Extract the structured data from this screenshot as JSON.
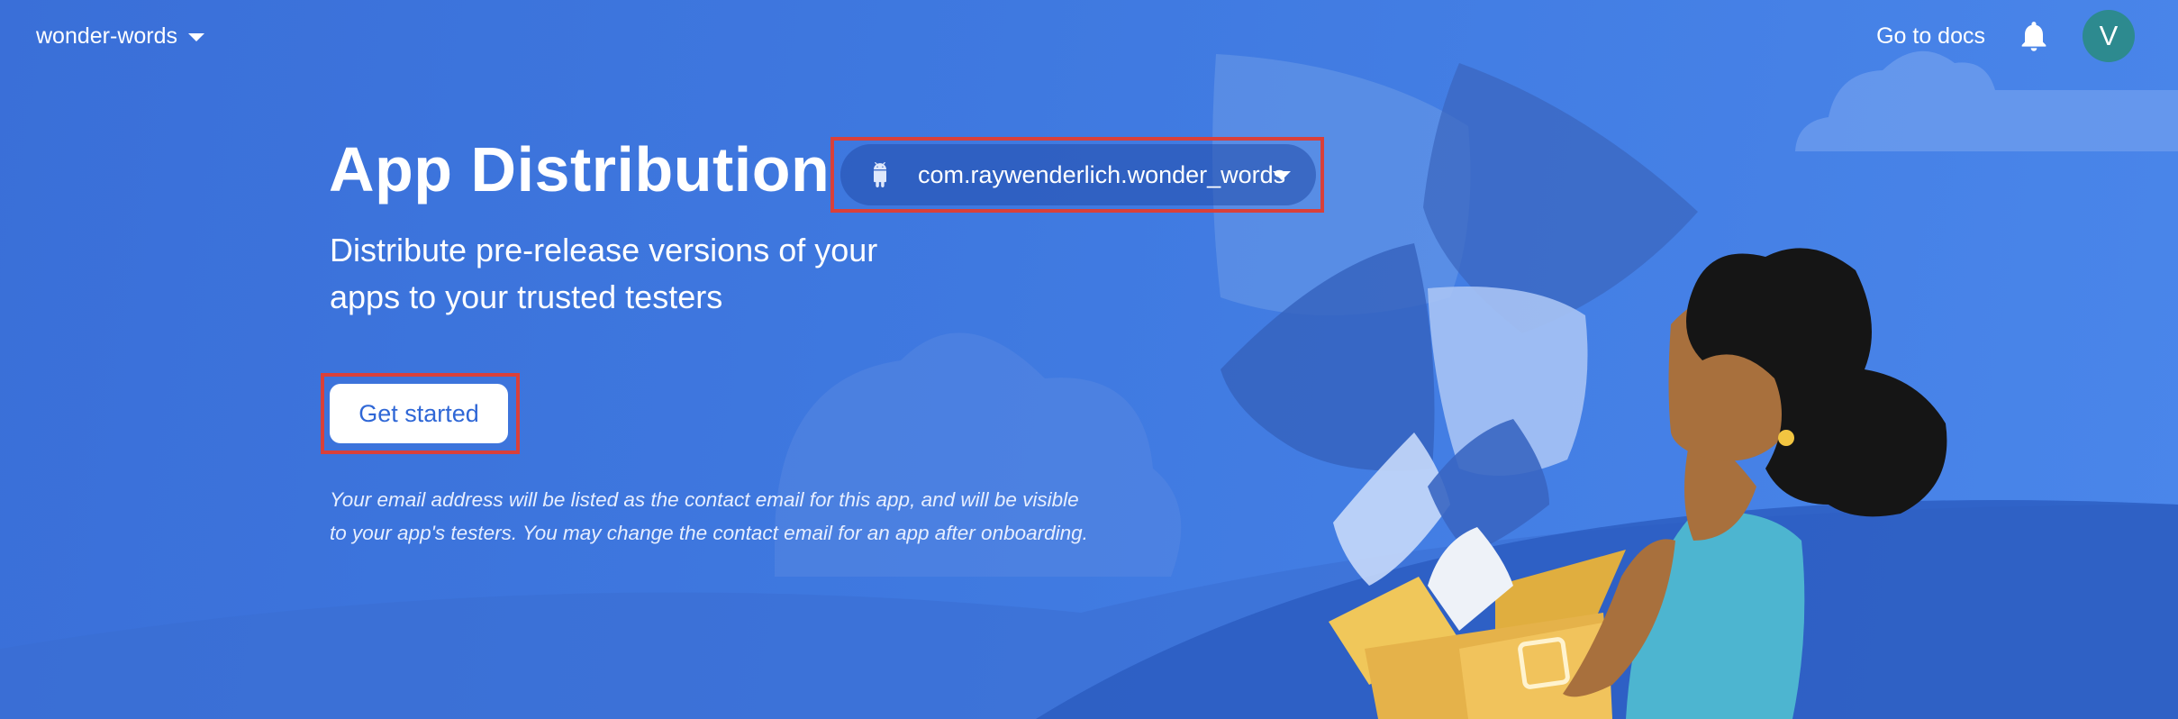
{
  "topbar": {
    "project_name": "wonder-words",
    "docs_link": "Go to docs",
    "avatar_initial": "V"
  },
  "hero": {
    "title": "App Distribution",
    "app_package": "com.raywenderlich.wonder_words",
    "subtitle_line1": "Distribute pre-release versions of your",
    "subtitle_line2": "apps to your trusted testers",
    "cta_label": "Get started",
    "notice_line1": "Your email address will be listed as the contact email for this app, and will be visible",
    "notice_line2": "to your app's testers. You may change the contact email for an app after onboarding."
  },
  "colors": {
    "background": "#3f79e0",
    "highlight_outline": "#d9403a",
    "button_text": "#2f67d6",
    "avatar": "#2d8a8f"
  },
  "icons": {
    "project_dropdown": "chevron-down-icon",
    "notifications": "bell-icon",
    "platform": "android-icon",
    "package_dropdown": "chevron-down-icon"
  }
}
